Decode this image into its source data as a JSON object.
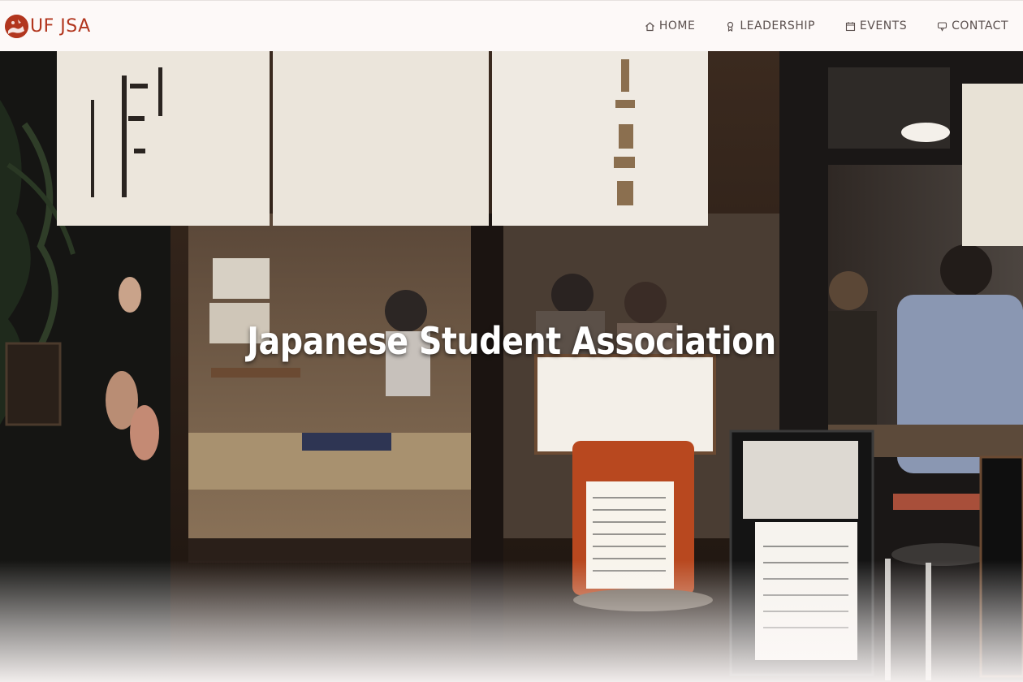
{
  "brand": {
    "name": "UF JSA",
    "accent_color": "#b2361e",
    "logo_icon": "red-sun-logo-icon"
  },
  "nav": {
    "items": [
      {
        "label": "HOME",
        "icon": "home-icon"
      },
      {
        "label": "LEADERSHIP",
        "icon": "person-icon"
      },
      {
        "label": "EVENTS",
        "icon": "calendar-icon"
      },
      {
        "label": "CONTACT",
        "icon": "chat-icon"
      }
    ]
  },
  "hero": {
    "title": "Japanese Student Association",
    "image": "japanese-restaurant-storefront-photo"
  }
}
